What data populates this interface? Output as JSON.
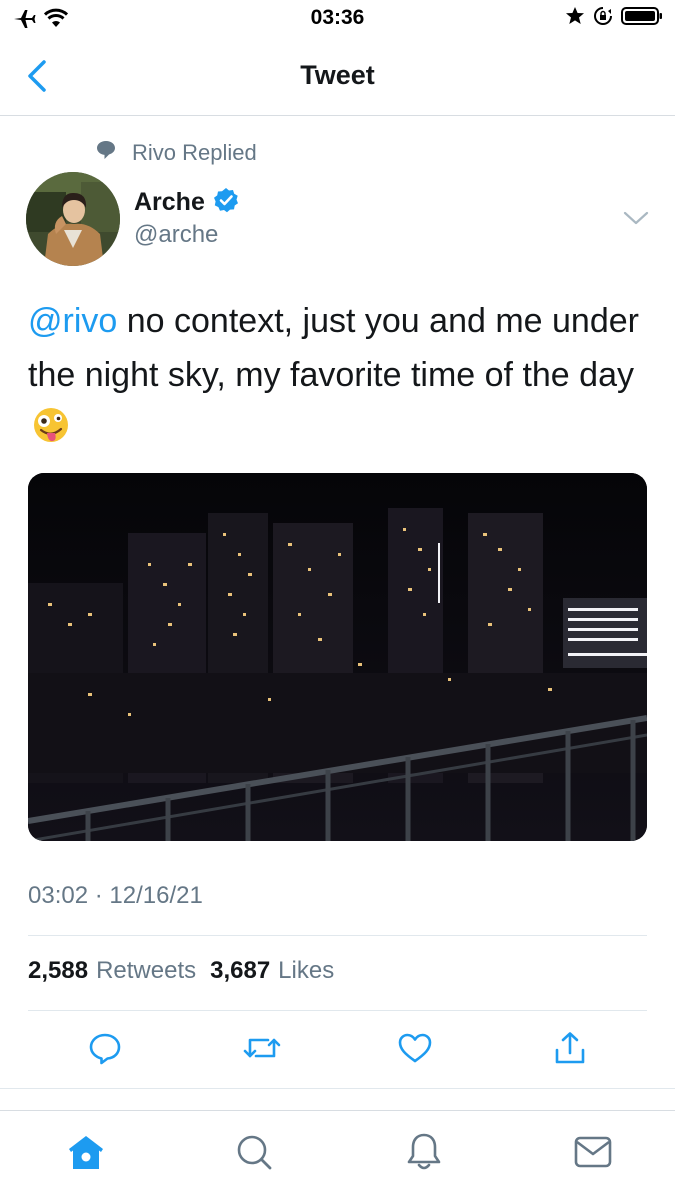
{
  "status_bar": {
    "time": "03:36",
    "left_icons": [
      "airplane-icon",
      "wifi-icon"
    ],
    "right_icons": [
      "star-icon",
      "orientation-lock-icon",
      "battery-icon"
    ]
  },
  "nav": {
    "title": "Tweet",
    "back_icon": "chevron-left-icon"
  },
  "reply_context": {
    "icon": "speech-bubble-icon",
    "text": "Rivo Replied"
  },
  "author": {
    "name": "Arche",
    "handle": "@arche",
    "verified_icon": "verified-badge-icon"
  },
  "tweet": {
    "mention": "@rivo",
    "text": " no context, just you and me under the night sky, my favorite time of the day ",
    "emoji": "zany-face-emoji",
    "media_alt_icon": "city-night-photo"
  },
  "meta": {
    "time": "03:02",
    "separator": " · ",
    "date": "12/16/21"
  },
  "stats": {
    "retweets_count": "2,588",
    "retweets_label": "Retweets",
    "likes_count": "3,687",
    "likes_label": "Likes"
  },
  "actions": [
    "reply-icon",
    "retweet-icon",
    "like-icon",
    "share-icon"
  ],
  "tab_bar": [
    "home-icon",
    "search-icon",
    "notifications-icon",
    "messages-icon"
  ],
  "colors": {
    "accent": "#1d9bf0",
    "secondary_text": "#657786",
    "primary_text": "#14171a",
    "divider": "#e1e8ed"
  }
}
